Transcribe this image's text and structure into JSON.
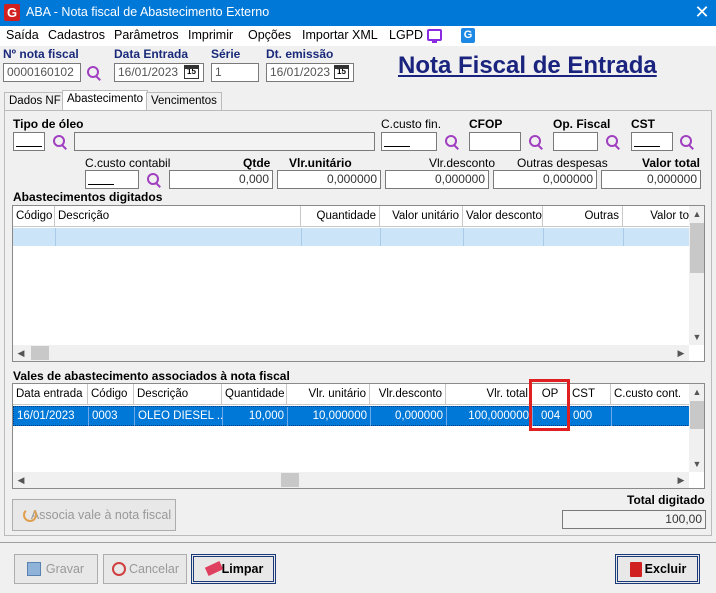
{
  "window": {
    "title": "ABA - Nota fiscal de Abastecimento Externo",
    "close_glyph": "✕",
    "app_icon_letter": "G"
  },
  "menu": {
    "items": [
      "Saída",
      "Cadastros",
      "Parâmetros",
      "Imprimir",
      "Opções",
      "Importar XML",
      "LGPD"
    ],
    "g_icon_letter": "G"
  },
  "header": {
    "nota_fiscal_label": "Nº nota fiscal",
    "nota_fiscal_value": "0000160102",
    "data_entrada_label": "Data Entrada",
    "data_entrada_value": "16/01/2023",
    "serie_label": "Série",
    "serie_value": "1",
    "dt_emissao_label": "Dt. emissão",
    "dt_emissao_value": "16/01/2023",
    "page_title": "Nota Fiscal de Entrada",
    "calendar_glyph": "15"
  },
  "tabs": [
    "Dados NF",
    "Abastecimento",
    "Vencimentos"
  ],
  "form": {
    "tipo_oleo_label": "Tipo de óleo",
    "ccusto_fin_label": "C.custo fin.",
    "cfop_label": "CFOP",
    "op_fiscal_label": "Op. Fiscal",
    "cst_label": "CST",
    "ccusto_contabil_label": "C.custo contabil",
    "qtde_label": "Qtde",
    "qtde_value": "0,000",
    "vlr_unitario_label": "Vlr.unitário",
    "vlr_unitario_value": "0,000000",
    "vlr_desconto_label": "Vlr.desconto",
    "vlr_desconto_value": "0,000000",
    "outras_despesas_label": "Outras despesas",
    "outras_despesas_value": "0,000000",
    "valor_total_label": "Valor total",
    "valor_total_value": "0,000000"
  },
  "abastecimentos": {
    "section_label": "Abastecimentos digitados",
    "columns": [
      "Código",
      "Descrição",
      "Quantidade",
      "Valor unitário",
      "Valor desconto",
      "Outras",
      "Valor to"
    ]
  },
  "vales": {
    "section_label": "Vales de abastecimento associados à nota fiscal",
    "columns": [
      "Data entrada",
      "Código",
      "Descrição",
      "Quantidade",
      "Vlr. unitário",
      "Vlr.desconto",
      "Vlr. total",
      "OP",
      "CST",
      "C.custo cont."
    ],
    "rows": [
      {
        "data_entrada": "16/01/2023",
        "codigo": "0003",
        "descricao": "OLEO DIESEL ...",
        "quantidade": "10,000",
        "vlr_unitario": "10,000000",
        "vlr_desconto": "0,000000",
        "vlr_total": "100,000000",
        "op": "004",
        "cst": "000",
        "ccusto_cont": ""
      }
    ]
  },
  "associa_button": "Associa vale à nota fiscal",
  "total": {
    "label": "Total digitado",
    "value": "100,00"
  },
  "footer": {
    "gravar": "Gravar",
    "cancelar": "Cancelar",
    "limpar": "Limpar",
    "excluir": "Excluir"
  },
  "colors": {
    "titlebar": "#0078d7",
    "selection": "#0078d7",
    "title_text": "#1a237e",
    "highlight": "#e02020"
  }
}
